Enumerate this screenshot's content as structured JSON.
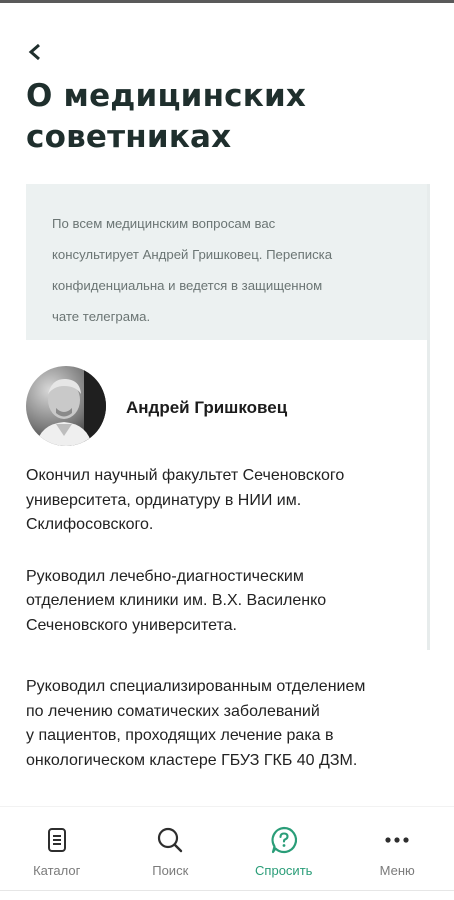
{
  "page": {
    "title": "О медицинских советниках"
  },
  "info_box": {
    "lines": [
      "По всем медицинским вопросам вас",
      "консультирует Андрей Гришковец. Переписка",
      "конфиденциальна и ведется в защищенном",
      "чате телеграма."
    ]
  },
  "advisor": {
    "name": "Андрей Гришковец"
  },
  "bio": {
    "p1": [
      "Окончил научный факультет Сеченовского",
      "университета, ординатуру в НИИ им.",
      "Склифосовского."
    ],
    "p2": [
      "Руководил лечебно-диагностическим",
      "отделением клиники им. В.Х. Василенко",
      "Сеченовского университета."
    ],
    "p3": [
      "Руководил специализированным отделением",
      "по лечению соматических заболеваний",
      "у пациентов, проходящих лечение рака в",
      "онкологическом кластере ГБУЗ ГКБ 40 ДЗМ."
    ]
  },
  "bottom_nav": {
    "items": [
      {
        "label": "Каталог",
        "icon": "catalog-icon",
        "active": false
      },
      {
        "label": "Поиск",
        "icon": "search-icon",
        "active": false
      },
      {
        "label": "Спросить",
        "icon": "ask-icon",
        "active": true
      },
      {
        "label": "Меню",
        "icon": "more-icon",
        "active": false
      }
    ]
  },
  "colors": {
    "accent": "#2a9d78",
    "title": "#1f2f2d",
    "info_bg": "#ecf1f1"
  }
}
